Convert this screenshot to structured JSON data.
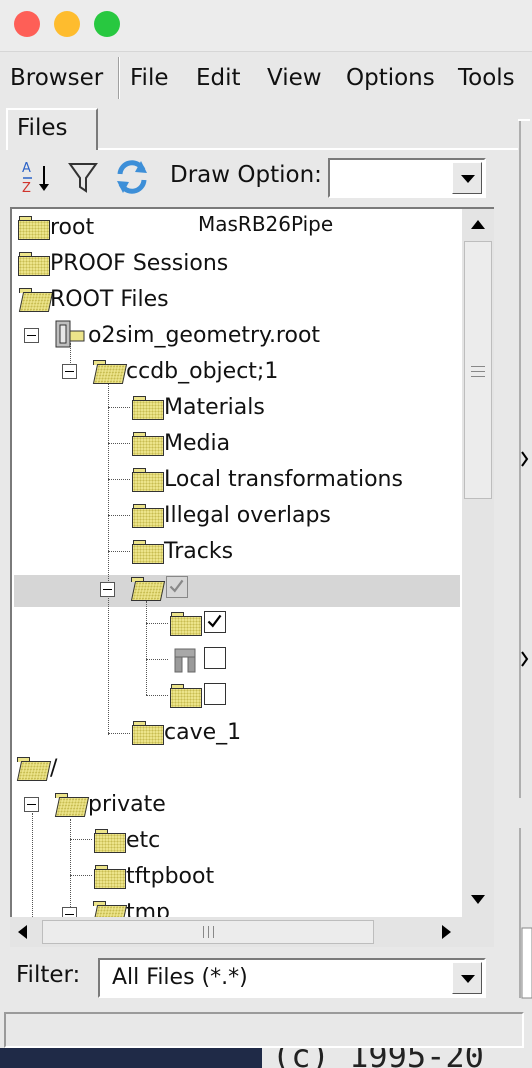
{
  "menu": {
    "browser": "Browser",
    "file": "File",
    "edit": "Edit",
    "view": "View",
    "options": "Options",
    "tools": "Tools"
  },
  "tabs": {
    "files": "Files"
  },
  "toolbar": {
    "draw_option_label": "Draw Option:",
    "draw_option_value": "",
    "icons": [
      "sort-icon",
      "filter-icon",
      "refresh-icon"
    ]
  },
  "tree": {
    "overlay_text": "MasRB26Pipe",
    "items": {
      "root": "root",
      "proof": "PROOF Sessions",
      "root_files": "ROOT Files",
      "geometry_file": "o2sim_geometry.root",
      "ccdb_object": "ccdb_object;1",
      "materials": "Materials",
      "media": "Media",
      "local_transformations": "Local transformations",
      "illegal_overlaps": "Illegal overlaps",
      "tracks": "Tracks",
      "cave": "cave_1",
      "slash": "/",
      "private": "private",
      "etc": "etc",
      "tftpboot": "tftpboot",
      "tmp": "tmp"
    },
    "checks": {
      "node_checked": true,
      "child1_checked": true,
      "child2_checked": false,
      "child3_checked": false
    }
  },
  "filter": {
    "label": "Filter:",
    "value": "All Files (*.*)"
  },
  "bottom": {
    "text": "(c) 1995-20"
  },
  "colors": {
    "folder": "#ece48a",
    "selection": "#d6d6d6",
    "close": "#fe5f57",
    "minimize": "#febc2e",
    "maximize": "#28c840"
  }
}
